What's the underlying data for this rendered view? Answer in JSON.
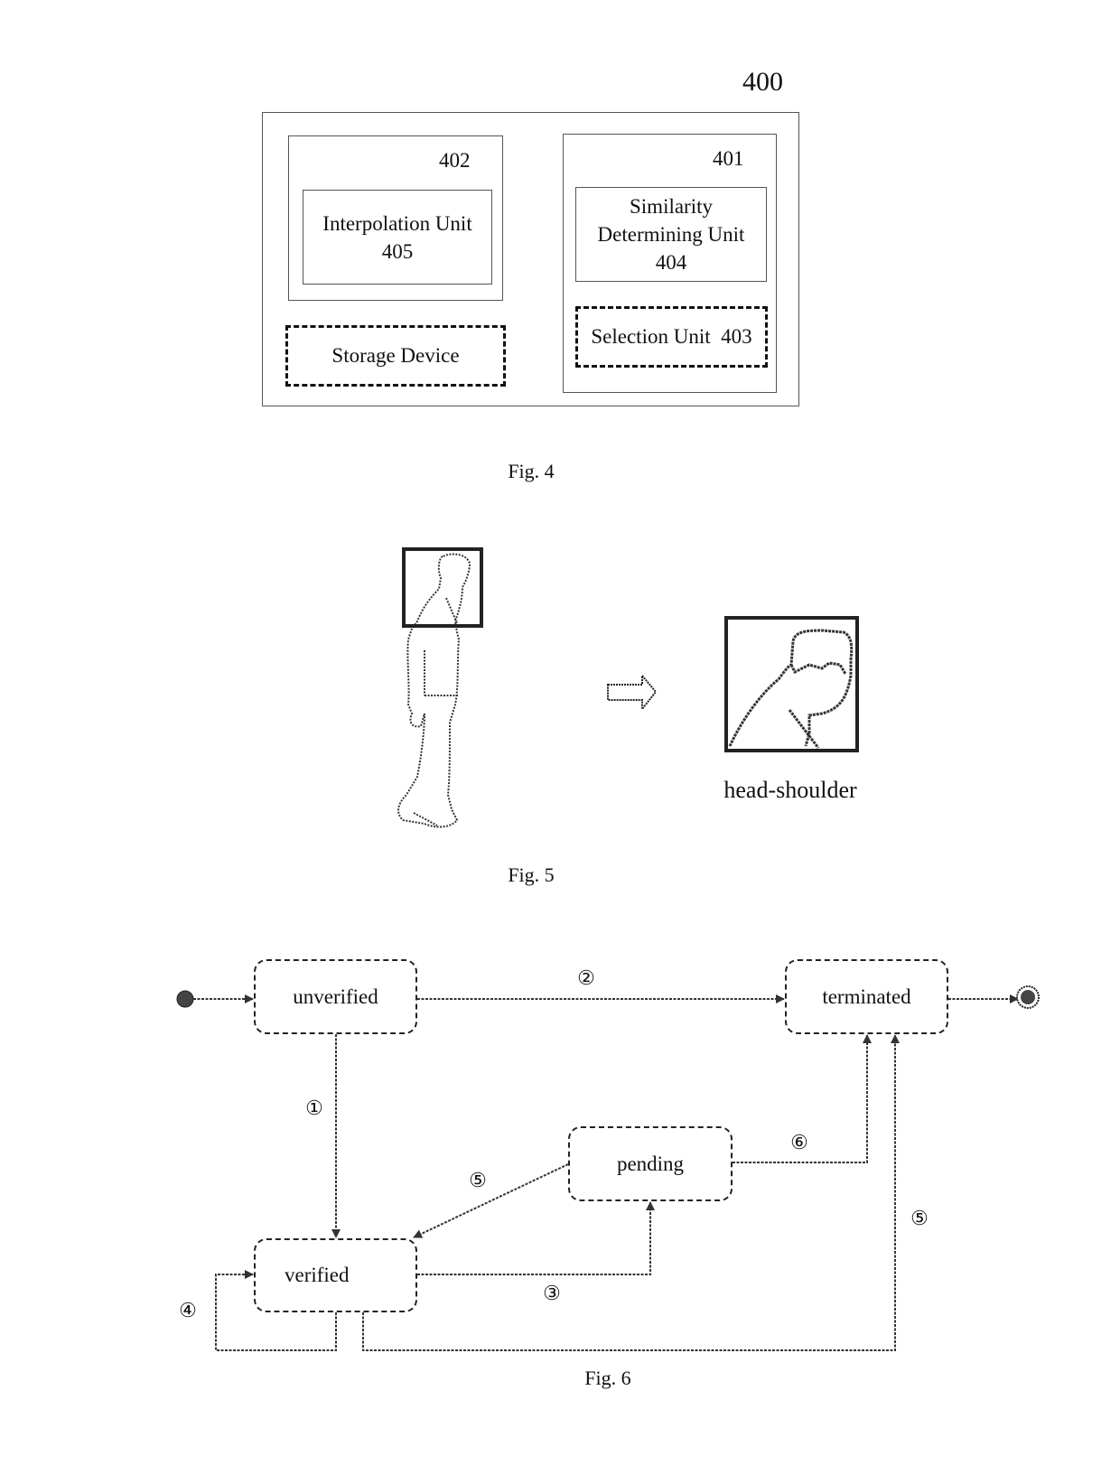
{
  "fig4": {
    "caption": "Fig. 4",
    "system_label": "400",
    "module_402": {
      "label": "402",
      "inner_unit": {
        "line1": "Interpolation Unit",
        "line2": "405"
      }
    },
    "storage_device": {
      "label": "Storage Device"
    },
    "module_401": {
      "label": "401",
      "similarity_unit": {
        "line1": "Similarity",
        "line2": "Determining Unit",
        "line3": "404"
      },
      "selection_unit": {
        "label": "Selection Unit  403"
      }
    }
  },
  "fig5": {
    "caption": "Fig. 5",
    "output_label": "head-shoulder",
    "arrow_icon": "hollow-right-arrow-icon"
  },
  "fig6": {
    "caption": "Fig. 6",
    "states": {
      "unverified": "unverified",
      "terminated": "terminated",
      "pending": "pending",
      "verified": "verified"
    },
    "transition_labels": {
      "t1": "①",
      "t2": "②",
      "t3": "③",
      "t4": "④",
      "t5a": "⑤",
      "t5b": "⑤",
      "t6": "⑥"
    }
  }
}
